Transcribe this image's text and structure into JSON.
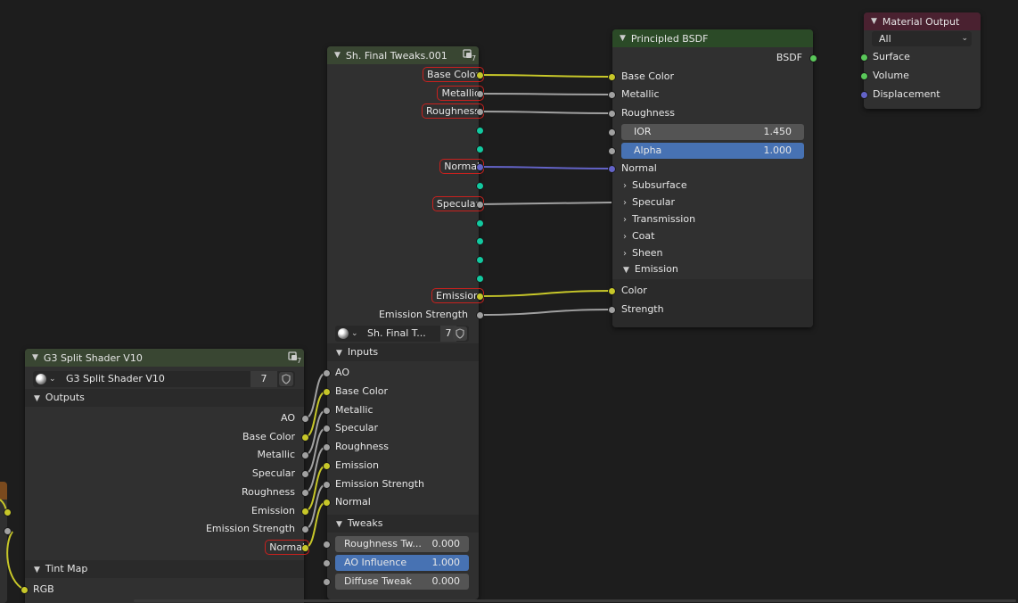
{
  "colors": {
    "background": "#1d1d1d",
    "node_body": "#303030",
    "group_header": "#394632",
    "shader_header": "#2b4a27",
    "output_header": "#4a2130",
    "field_blue": "#4772b3",
    "field_gray": "#545454",
    "highlight": "#c8211e",
    "socket_color": "#c7c729",
    "socket_float": "#a1a1a1",
    "socket_vector": "#6363c7",
    "socket_shader": "#5ac85a",
    "socket_teal": "#12c9a0"
  },
  "final_tweaks": {
    "title": "Sh. Final Tweaks.001",
    "users_badge": "7",
    "outputs": {
      "base_color": "Base Color",
      "metallic": "Metallic",
      "roughness": "Roughness",
      "normal": "Normal",
      "specular": "Specular",
      "emission": "Emission",
      "emission_strength": "Emission Strength"
    },
    "datablock_name": "Sh. Final T...",
    "datablock_users": "7",
    "inputs_panel": "Inputs",
    "inputs": {
      "ao": "AO",
      "base_color": "Base Color",
      "metallic": "Metallic",
      "specular": "Specular",
      "roughness": "Roughness",
      "emission": "Emission",
      "emission_strength": "Emission Strength",
      "normal": "Normal"
    },
    "tweaks_panel": "Tweaks",
    "tweaks": [
      {
        "label": "Roughness Tw...",
        "value": "0.000"
      },
      {
        "label": "AO Influence",
        "value": "1.000"
      },
      {
        "label": "Diffuse Tweak",
        "value": "0.000"
      }
    ]
  },
  "principled": {
    "title": "Principled BSDF",
    "output": "BSDF",
    "inputs": {
      "base_color": "Base Color",
      "metallic": "Metallic",
      "roughness": "Roughness",
      "normal": "Normal"
    },
    "ior": {
      "label": "IOR",
      "value": "1.450"
    },
    "alpha": {
      "label": "Alpha",
      "value": "1.000"
    },
    "panels": {
      "subsurface": "Subsurface",
      "specular": "Specular",
      "transmission": "Transmission",
      "coat": "Coat",
      "sheen": "Sheen",
      "emission": "Emission"
    },
    "emission_inputs": {
      "color": "Color",
      "strength": "Strength"
    }
  },
  "material_output": {
    "title": "Material Output",
    "target": "All",
    "inputs": {
      "surface": "Surface",
      "volume": "Volume",
      "displacement": "Displacement"
    }
  },
  "split_shader": {
    "title": "G3 Split Shader V10",
    "users_badge": "7",
    "datablock_name": "G3 Split Shader V10",
    "datablock_users": "7",
    "outputs_panel": "Outputs",
    "outputs": {
      "ao": "AO",
      "base_color": "Base Color",
      "metallic": "Metallic",
      "specular": "Specular",
      "roughness": "Roughness",
      "emission": "Emission",
      "emission_strength": "Emission Strength",
      "normal": "Normal"
    },
    "tint_panel": "Tint Map",
    "tint_rgb": "RGB"
  }
}
